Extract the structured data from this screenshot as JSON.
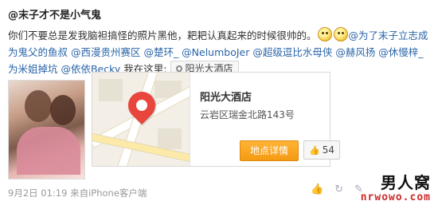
{
  "post": {
    "author": "@末子才不是小气鬼",
    "text_part1": "你们不要总是发我脑袒搞怪的照片黑他，耙耙认真起来的时候很帅的。",
    "emoji": [
      "glare-emoji",
      "glare-emoji"
    ],
    "mentions_line": "@为了末子立志成为鬼父的鱼叔 @西漫贵州赛区 @楚环_ @NelumboJer @超级逗比水母侠 @赫风扬 @休慢梓_为米姐掉坑 @依依Becky",
    "location_prefix": "我在这里:",
    "location_tag": "阳光大酒店"
  },
  "card": {
    "place_name": "阳光大酒店",
    "address": "云岩区瑞金北路143号",
    "detail_button": "地点详情",
    "like_count": "54"
  },
  "meta": {
    "date": "9月2日 01:19",
    "from_label": "来自",
    "client": "iPhone客户端"
  },
  "watermark": {
    "top": "男人窝",
    "bottom": "nrwowo.com"
  }
}
